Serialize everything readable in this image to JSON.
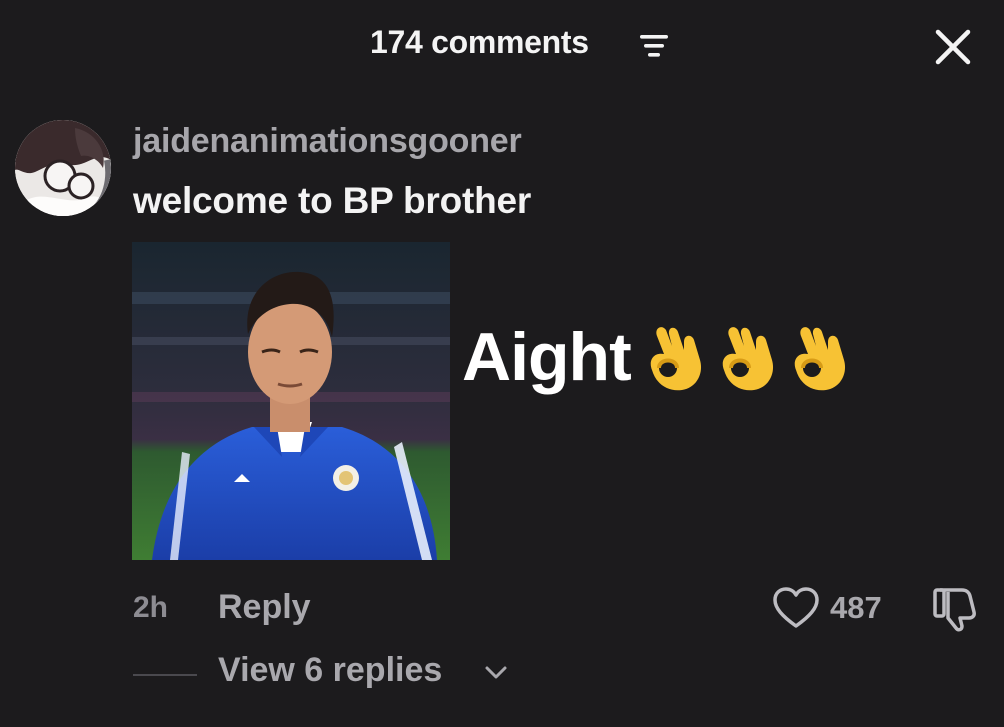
{
  "header": {
    "title": "174 comments",
    "filter_icon": "filter-icon",
    "close_icon": "close-icon"
  },
  "comment": {
    "username": "jaidenanimationsgooner",
    "text": "welcome to BP brother",
    "sticker_text": "Aight",
    "sticker_emoji": [
      "ok-hand-emoji",
      "ok-hand-emoji",
      "ok-hand-emoji"
    ],
    "time": "2h",
    "reply_label": "Reply",
    "like_count": "487",
    "view_replies_label": "View 6 replies"
  },
  "colors": {
    "background": "#1c1b1d",
    "primary_text": "#f3f3f3",
    "secondary_text": "#a9a8ad",
    "emoji_yellow": "#f7c234"
  }
}
